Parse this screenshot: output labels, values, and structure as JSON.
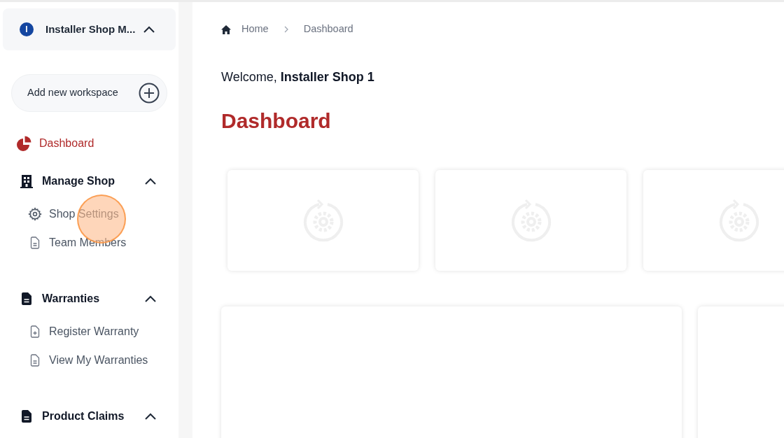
{
  "workspace": {
    "initial": "I",
    "name": "Installer Shop M...",
    "expanded": true
  },
  "add_workspace": {
    "label": "Add new workspace"
  },
  "nav": [
    {
      "kind": "link",
      "label": "Dashboard",
      "selected": true
    },
    {
      "kind": "section",
      "label": "Manage Shop",
      "expanded": true,
      "children": [
        {
          "label": "Shop Settings",
          "selected": false
        },
        {
          "label": "Team Members",
          "selected": false
        }
      ]
    },
    {
      "kind": "section",
      "label": "Warranties",
      "expanded": true,
      "children": [
        {
          "label": "Register Warranty",
          "selected": false
        },
        {
          "label": "View My Warranties",
          "selected": false
        }
      ]
    },
    {
      "kind": "section",
      "label": "Product Claims",
      "expanded": true
    }
  ],
  "breadcrumb": [
    "Home",
    "Dashboard"
  ],
  "welcome": "Welcome, **Installer Shop 1**",
  "title": "Dashboard",
  "stat_cards": [
    {
      "loading": true
    },
    {
      "loading": true
    },
    {
      "loading": true
    }
  ],
  "panels": [
    {
      "kind": "wide"
    },
    {
      "kind": "narrow"
    }
  ]
}
